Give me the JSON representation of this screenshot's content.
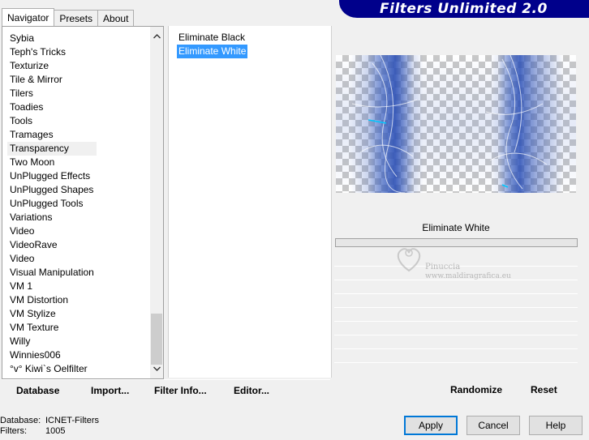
{
  "tabs": [
    {
      "label": "Navigator",
      "active": true
    },
    {
      "label": "Presets",
      "active": false
    },
    {
      "label": "About",
      "active": false
    }
  ],
  "banner": {
    "title": "Filters Unlimited 2.0"
  },
  "categories": {
    "items": [
      "Sybia",
      "Teph's Tricks",
      "Texturize",
      "Tile & Mirror",
      "Tilers",
      "Toadies",
      "Tools",
      "Tramages",
      "Transparency",
      "Two Moon",
      "UnPlugged Effects",
      "UnPlugged Shapes",
      "UnPlugged Tools",
      "Variations",
      "Video",
      "VideoRave",
      "Video",
      "Visual Manipulation",
      "VM 1",
      "VM Distortion",
      "VM Stylize",
      "VM Texture",
      "Willy",
      "Winnies006",
      "°v° Kiwi`s Oelfilter"
    ],
    "selected": "Transparency"
  },
  "filters": {
    "items": [
      "Eliminate Black",
      "Eliminate White"
    ],
    "selected": "Eliminate White"
  },
  "settings": {
    "filter_name": "Eliminate White"
  },
  "watermark": {
    "line1": "Pinuccia",
    "line2": "www.maldiragrafica.eu"
  },
  "toolbar": {
    "database": "Database",
    "import": "Import...",
    "filter_info": "Filter Info...",
    "editor": "Editor...",
    "randomize": "Randomize",
    "reset": "Reset"
  },
  "status": {
    "database_label": "Database:",
    "database_value": "ICNET-Filters",
    "filters_label": "Filters:",
    "filters_value": "1005"
  },
  "buttons": {
    "apply": "Apply",
    "cancel": "Cancel",
    "help": "Help"
  },
  "colors": {
    "selection": "#3399ff",
    "banner": "#00008b",
    "preview_tint": "#3a5fbf"
  }
}
